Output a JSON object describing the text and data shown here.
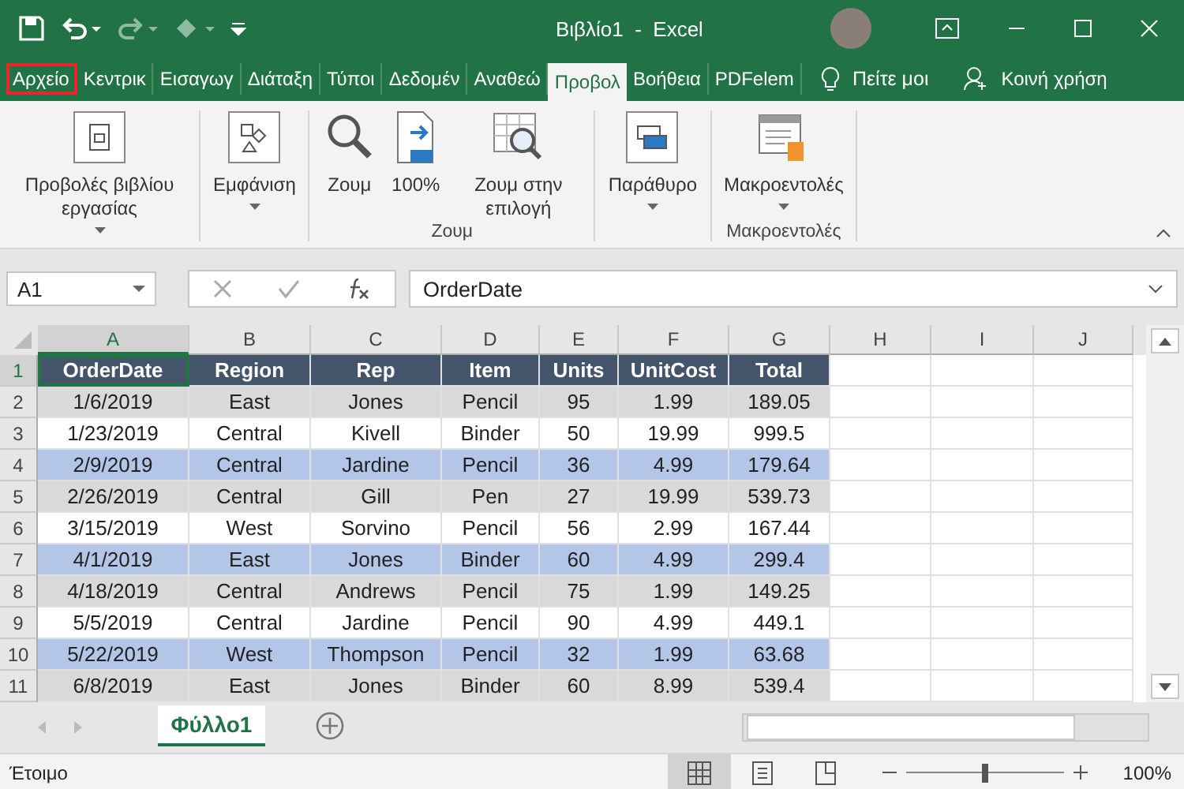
{
  "window": {
    "title": "Βιβλίο1  -  Excel"
  },
  "tabs": [
    {
      "label": "Αρχείο",
      "selected": false,
      "outlined": true
    },
    {
      "label": "Κεντρικ",
      "selected": false,
      "outlined": false
    },
    {
      "label": "Εισαγωγ",
      "selected": false,
      "outlined": false
    },
    {
      "label": "Διάταξη",
      "selected": false,
      "outlined": false
    },
    {
      "label": "Τύποι",
      "selected": false,
      "outlined": false
    },
    {
      "label": "Δεδομέν",
      "selected": false,
      "outlined": false
    },
    {
      "label": "Αναθεώ",
      "selected": false,
      "outlined": false
    },
    {
      "label": "Προβολ",
      "selected": true,
      "outlined": false
    },
    {
      "label": "Βοήθεια",
      "selected": false,
      "outlined": false
    },
    {
      "label": "PDFelem",
      "selected": false,
      "outlined": false
    }
  ],
  "tell_me": "Πείτε μοι",
  "share": "Κοινή χρήση",
  "ribbon_groups": [
    {
      "buttons": [
        {
          "kind": "workbook-views",
          "label": "Προβολές βιβλίου εργασίας",
          "dropdown": true
        }
      ]
    },
    {
      "buttons": [
        {
          "kind": "show",
          "label": "Εμφάνιση",
          "dropdown": true
        }
      ]
    },
    {
      "label": "Ζουμ",
      "buttons": [
        {
          "kind": "zoom",
          "label": "Ζουμ",
          "dropdown": false
        },
        {
          "kind": "hundred",
          "label": "100%",
          "dropdown": false
        },
        {
          "kind": "zoom-selection",
          "label": "Ζουμ στην επιλογή",
          "dropdown": false
        }
      ]
    },
    {
      "buttons": [
        {
          "kind": "window",
          "label": "Παράθυρο",
          "dropdown": true
        }
      ]
    },
    {
      "label": "Μακροεντολές",
      "buttons": [
        {
          "kind": "macros",
          "label": "Μακροεντολές",
          "dropdown": true
        }
      ]
    }
  ],
  "name_box": "A1",
  "formula": "OrderDate",
  "columns": [
    {
      "label": "A",
      "selected": true
    },
    {
      "label": "B",
      "selected": false
    },
    {
      "label": "C",
      "selected": false
    },
    {
      "label": "D",
      "selected": false
    },
    {
      "label": "E",
      "selected": false
    },
    {
      "label": "F",
      "selected": false
    },
    {
      "label": "G",
      "selected": false
    },
    {
      "label": "H",
      "selected": false
    },
    {
      "label": "I",
      "selected": false
    },
    {
      "label": "J",
      "selected": false
    }
  ],
  "rows": [
    {
      "number": "1",
      "selected": true,
      "kind": "header",
      "color": "#44546a",
      "cells": [
        "OrderDate",
        "Region",
        "Rep",
        "Item",
        "Units",
        "UnitCost",
        "Total"
      ]
    },
    {
      "number": "2",
      "selected": false,
      "kind": "data",
      "color": "#d9d9d9",
      "cells": [
        "1/6/2019",
        "East",
        "Jones",
        "Pencil",
        "95",
        "1.99",
        "189.05"
      ]
    },
    {
      "number": "3",
      "selected": false,
      "kind": "data",
      "color": "#ffffff",
      "cells": [
        "1/23/2019",
        "Central",
        "Kivell",
        "Binder",
        "50",
        "19.99",
        "999.5"
      ]
    },
    {
      "number": "4",
      "selected": false,
      "kind": "data",
      "color": "#b4c6e7",
      "cells": [
        "2/9/2019",
        "Central",
        "Jardine",
        "Pencil",
        "36",
        "4.99",
        "179.64"
      ]
    },
    {
      "number": "5",
      "selected": false,
      "kind": "data",
      "color": "#d9d9d9",
      "cells": [
        "2/26/2019",
        "Central",
        "Gill",
        "Pen",
        "27",
        "19.99",
        "539.73"
      ]
    },
    {
      "number": "6",
      "selected": false,
      "kind": "data",
      "color": "#ffffff",
      "cells": [
        "3/15/2019",
        "West",
        "Sorvino",
        "Pencil",
        "56",
        "2.99",
        "167.44"
      ]
    },
    {
      "number": "7",
      "selected": false,
      "kind": "data",
      "color": "#b4c6e7",
      "cells": [
        "4/1/2019",
        "East",
        "Jones",
        "Binder",
        "60",
        "4.99",
        "299.4"
      ]
    },
    {
      "number": "8",
      "selected": false,
      "kind": "data",
      "color": "#d9d9d9",
      "cells": [
        "4/18/2019",
        "Central",
        "Andrews",
        "Pencil",
        "75",
        "1.99",
        "149.25"
      ]
    },
    {
      "number": "9",
      "selected": false,
      "kind": "data",
      "color": "#ffffff",
      "cells": [
        "5/5/2019",
        "Central",
        "Jardine",
        "Pencil",
        "90",
        "4.99",
        "449.1"
      ]
    },
    {
      "number": "10",
      "selected": false,
      "kind": "data",
      "color": "#b4c6e7",
      "cells": [
        "5/22/2019",
        "West",
        "Thompson",
        "Pencil",
        "32",
        "1.99",
        "63.68"
      ]
    },
    {
      "number": "11",
      "selected": false,
      "kind": "data",
      "color": "#d9d9d9",
      "cells": [
        "6/8/2019",
        "East",
        "Jones",
        "Binder",
        "60",
        "8.99",
        "539.4"
      ]
    }
  ],
  "sheets": [
    {
      "label": "Φύλλο1",
      "selected": true
    }
  ],
  "status": "Έτοιμο",
  "view_modes": [
    {
      "kind": "normal",
      "selected": true
    },
    {
      "kind": "page-layout",
      "selected": false
    },
    {
      "kind": "page-break",
      "selected": false
    }
  ],
  "zoom": {
    "level": 0.5,
    "reading": "100%"
  }
}
